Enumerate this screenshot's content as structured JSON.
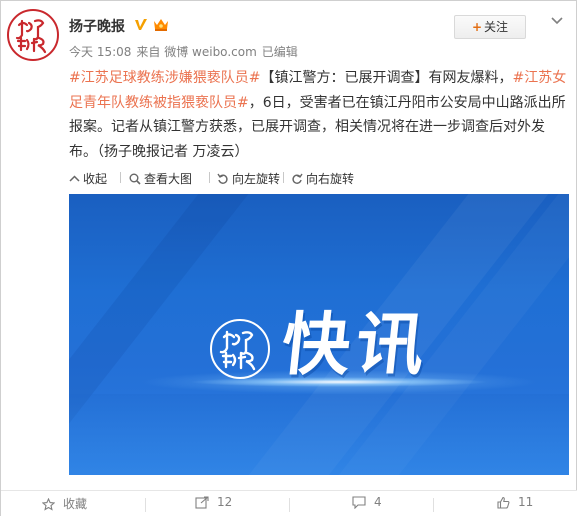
{
  "account": {
    "name": "扬子晚报",
    "avatar_text": "扬子晚报",
    "verified_icon": "verified-v-icon",
    "member_icon": "crown-icon"
  },
  "meta": {
    "time": "今天 15:08",
    "source": "来自 微博 weibo.com",
    "edited": "已编辑"
  },
  "follow_button": {
    "plus": "+",
    "label": "关注"
  },
  "post": {
    "topic1": "#江苏足球教练涉嫌猥亵队员#",
    "text1": "【镇江警方：已展开调查】有网友爆料，",
    "topic2": "#江苏女足青年队教练被指猥亵队员#",
    "text2": "，6日，受害者已在镇江丹阳市公安局中山路派出所报案。记者从镇江警方获悉，已展开调查，相关情况将在进一步调查后对外发布。（扬子晚报记者 万凌云）"
  },
  "media_toolbar": {
    "collapse": "收起",
    "view_large": "查看大图",
    "rotate_left": "向左旋转",
    "rotate_right": "向右旋转"
  },
  "image": {
    "title": "快讯",
    "logo_text": "扬子晚报",
    "colors": {
      "background": "#1f6fd4",
      "title": "#ffffff"
    }
  },
  "actions": {
    "favorite": "收藏",
    "repost_count": "12",
    "comment_count": "4",
    "like_count": "11"
  },
  "colors": {
    "topic": "#eb7350",
    "brand_red": "#c9282d",
    "meta_gray": "#808080"
  }
}
